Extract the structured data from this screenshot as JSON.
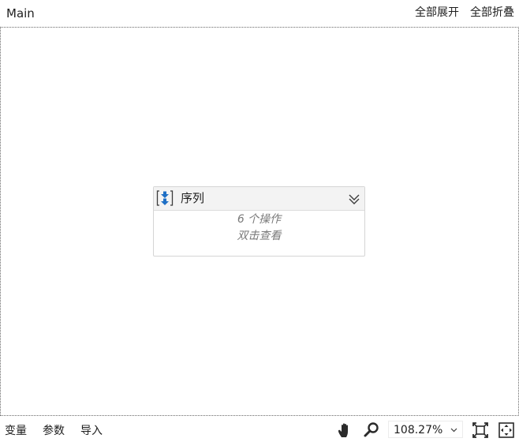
{
  "header": {
    "title": "Main",
    "expand_all": "全部展开",
    "collapse_all": "全部折叠"
  },
  "activity": {
    "title": "序列",
    "icon": "sequence-icon",
    "body_line1": "6 个操作",
    "body_line2": "双击查看"
  },
  "statusbar": {
    "tabs": [
      "变量",
      "参数",
      "导入"
    ],
    "zoom": "108.27%",
    "tools": [
      "hand-pan-icon",
      "zoom-search-icon",
      "fit-to-screen-icon",
      "overview-icon"
    ]
  },
  "colors": {
    "icon_blue": "#1e6fc5",
    "border_dotted": "#6a6a6a",
    "muted_text": "#7a7a7a",
    "header_bg": "#f3f3f3"
  }
}
